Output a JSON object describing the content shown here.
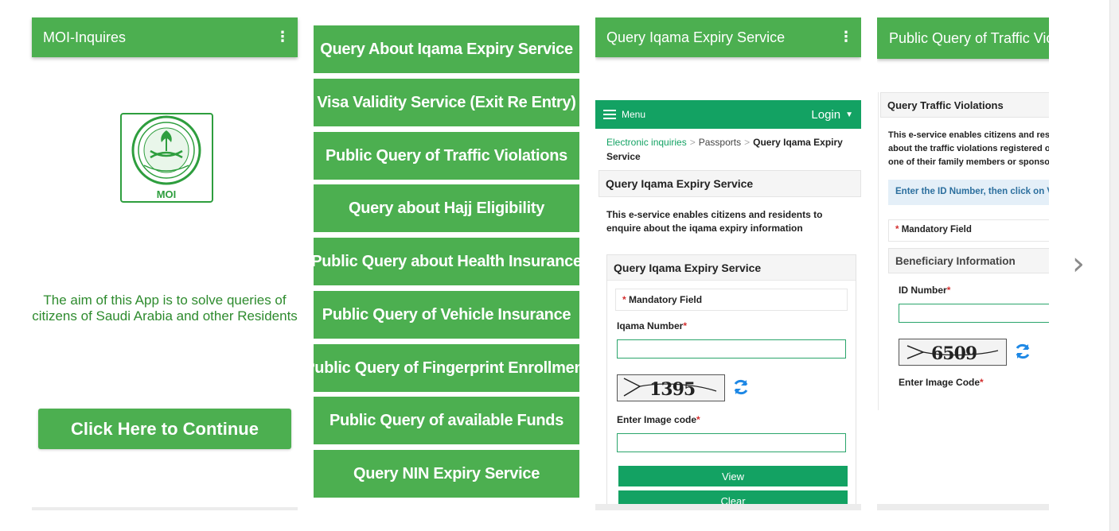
{
  "screen1": {
    "title": "MOI-Inquires",
    "kebab": "⋮",
    "logo_text": "MOI",
    "aim_text": "The aim of this App is to solve queries of citizens  of Saudi Arabia and other Residents",
    "continue_label": "Click Here to Continue"
  },
  "screen2": {
    "items": [
      {
        "label": "Query About Iqama Expiry Service"
      },
      {
        "label": "Visa Validity Service (Exit Re Entry)"
      },
      {
        "label": "Public Query of Traffic Violations"
      },
      {
        "label": "Query about Hajj Eligibility"
      },
      {
        "label": "Public Query about Health Insurance"
      },
      {
        "label": "Public Query of Vehicle Insurance"
      },
      {
        "label": "Public Query of Fingerprint Enrollment"
      },
      {
        "label": "Public Query of available Funds"
      },
      {
        "label": "Query NIN Expiry Service"
      }
    ]
  },
  "screen3": {
    "title": "Query Iqama Expiry Service",
    "kebab": "⋮",
    "nav_menu": "Menu",
    "nav_login": "Login",
    "crumb1": "Electronic inquiries",
    "crumb2": "Passports",
    "crumb3": "Query Iqama Expiry Service",
    "crumb_sep": ">",
    "section_title": "Query Iqama Expiry Service",
    "description": "This e-service enables citizens and residents to enquire about the iqama expiry information",
    "card_title": "Query Iqama Expiry Service",
    "asterisk": "*",
    "mandatory": "Mandatory Field",
    "iqama_label": "Iqama Number",
    "captcha_code": "1395",
    "image_code_label": "Enter Image code",
    "view_label": "View",
    "clear_label": "Clear"
  },
  "screen4": {
    "title": "Public Query of Traffic Violations",
    "section_title": "Query Traffic Violations",
    "desc_line1": "This e-service enables citizens and residents to enquire",
    "desc_line2": "about the traffic violations registered on them or",
    "desc_line3": "one of their family members or sponsored persons",
    "info": "Enter the ID Number, then click on View",
    "asterisk": "*",
    "mandatory": "Mandatory Field",
    "beneficiary": "Beneficiary Information",
    "id_label": "ID Number",
    "captcha_code": "6509",
    "image_code_label": "Enter Image Code"
  },
  "colors": {
    "app_green": "#4caf50",
    "web_green": "#13a263",
    "required_red": "#d32f2f"
  },
  "icons": {
    "next": "chevron-right-icon",
    "refresh": "refresh-icon",
    "menu": "hamburger-icon",
    "more": "kebab-menu-icon"
  }
}
